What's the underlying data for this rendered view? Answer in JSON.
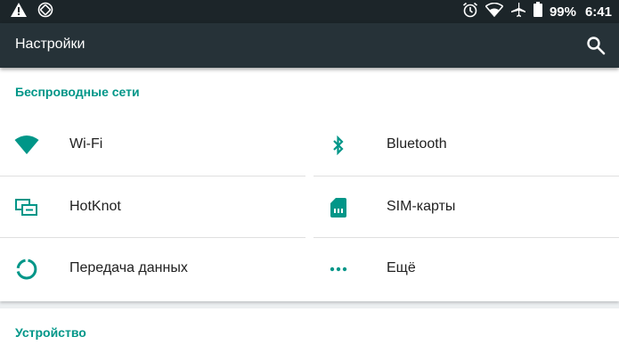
{
  "status_bar": {
    "battery_percent": "99%",
    "time": "6:41",
    "icons": [
      "warning-icon",
      "screen-rotation-icon",
      "alarm-icon",
      "wifi-signal-icon",
      "airplane-icon",
      "battery-icon"
    ]
  },
  "toolbar": {
    "title": "Настройки",
    "search_icon": "search-icon"
  },
  "sections": [
    {
      "title": "Беспроводные сети",
      "tiles": [
        {
          "label": "Wi-Fi",
          "icon": "wifi-icon"
        },
        {
          "label": "Bluetooth",
          "icon": "bluetooth-icon"
        },
        {
          "label": "HotKnot",
          "icon": "hotknot-icon"
        },
        {
          "label": "SIM-карты",
          "icon": "sim-card-icon"
        },
        {
          "label": "Передача данных",
          "icon": "data-usage-icon"
        },
        {
          "label": "Ещё",
          "icon": "more-icon"
        }
      ]
    },
    {
      "title": "Устройство"
    }
  ],
  "colors": {
    "accent": "#009688",
    "toolbar": "#263238",
    "status_bar": "#1c2529"
  }
}
